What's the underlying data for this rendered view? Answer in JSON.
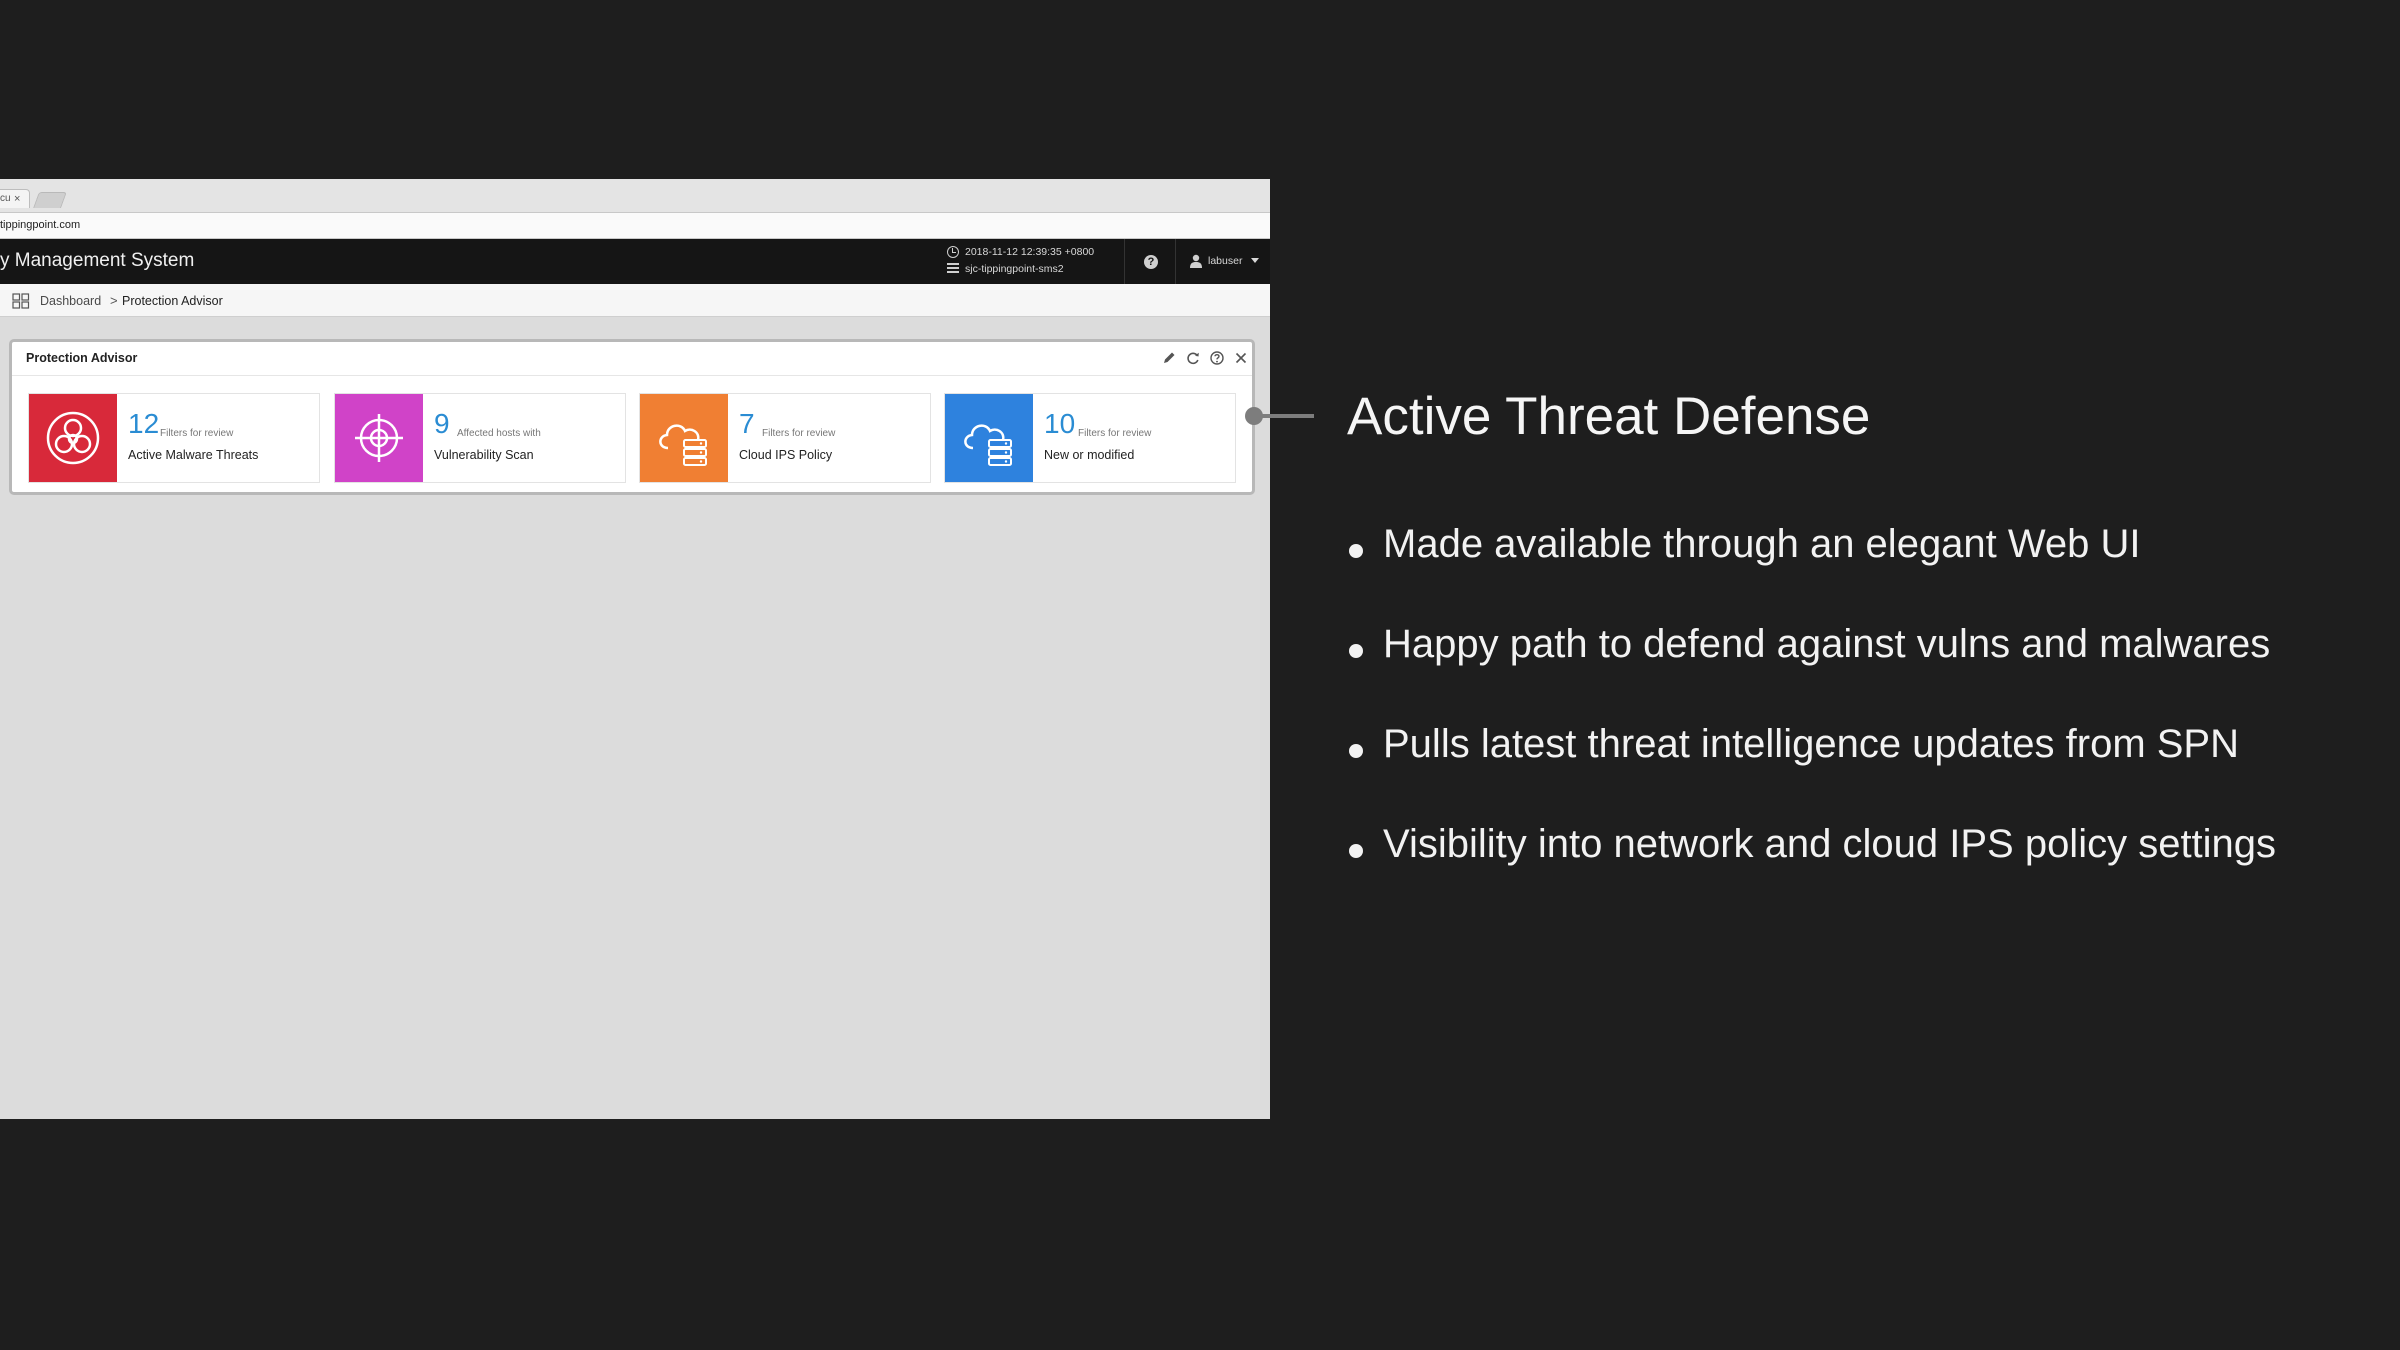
{
  "browser": {
    "tab_title": "cu",
    "tab_close": "×",
    "url": "tippingpoint.com"
  },
  "app": {
    "title": "y Management System",
    "timestamp": "2018-11-12 12:39:35 +0800",
    "server": "sjc-tippingpoint-sms2",
    "help_glyph": "?",
    "user": "labuser"
  },
  "breadcrumb": {
    "root": "Dashboard",
    "separator": ">",
    "current": "Protection Advisor"
  },
  "widget": {
    "title": "Protection Advisor",
    "cards": [
      {
        "number": "12",
        "sub": "Filters for review",
        "label": "Active Malware Threats",
        "color": "#d8293a",
        "icon": "biohazard-icon"
      },
      {
        "number": "9",
        "sub": "Affected hosts with",
        "label": "Vulnerability Scan",
        "color": "#d043c8",
        "icon": "crosshair-icon"
      },
      {
        "number": "7",
        "sub": "Filters for review",
        "label": "Cloud IPS Policy",
        "color": "#f07f33",
        "icon": "cloud-server-icon"
      },
      {
        "number": "10",
        "sub": "Filters for review",
        "label": "New or modified",
        "color": "#2e82de",
        "icon": "cloud-server-icon"
      }
    ]
  },
  "slide": {
    "title": "Active Threat Defense",
    "bullets": [
      "Made available through an elegant Web UI",
      "Happy path to defend against vulns and malwares",
      "Pulls latest threat intelligence updates from SPN",
      "Visibility into network and cloud IPS policy settings"
    ]
  }
}
